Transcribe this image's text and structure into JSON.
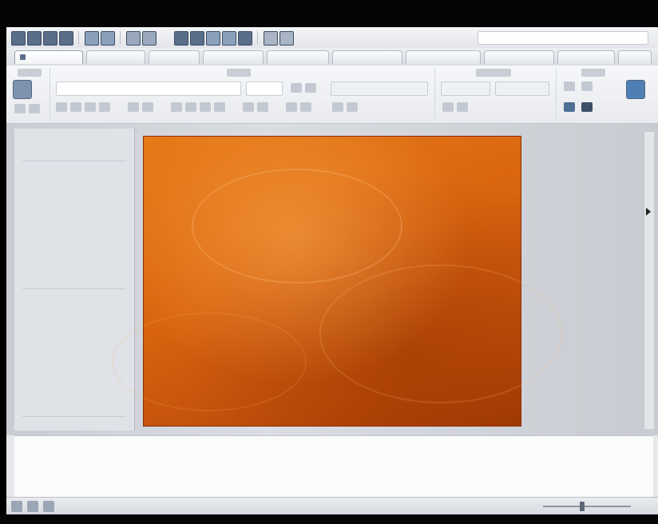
{
  "window": {
    "title": ""
  },
  "ribbon": {
    "tabs": [
      {
        "label": ""
      },
      {
        "label": ""
      },
      {
        "label": ""
      },
      {
        "label": ""
      },
      {
        "label": ""
      },
      {
        "label": ""
      },
      {
        "label": ""
      },
      {
        "label": ""
      },
      {
        "label": ""
      },
      {
        "label": ""
      }
    ]
  },
  "slide": {
    "title_line1": "",
    "title_line2": "",
    "subtitle": ""
  },
  "notes": {
    "placeholder": ""
  },
  "status": {
    "left_text": "",
    "view_text": "",
    "zoom_text": ""
  },
  "colors": {
    "slide_background": "#d8640f",
    "title_text": "#79b14c",
    "title_outline": "#3b6fa6",
    "subtitle_text": "#ffd9b6"
  }
}
